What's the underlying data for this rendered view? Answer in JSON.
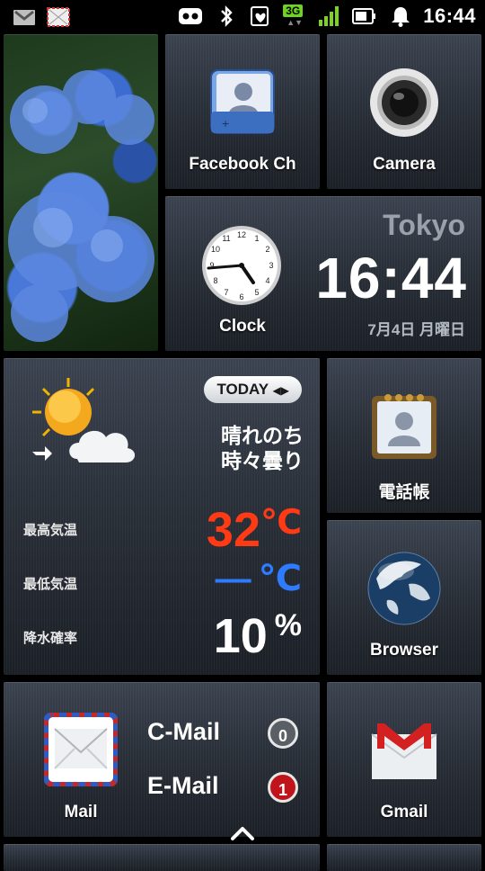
{
  "status_bar": {
    "left_icons": [
      "gmail-notification-icon",
      "mail-notification-icon"
    ],
    "right_icons": [
      "voicemail-icon",
      "bluetooth-icon",
      "heart-app-icon",
      "3g-icon",
      "signal-icon",
      "battery-icon",
      "alarm-bell-icon"
    ],
    "network": "3G",
    "time": "16:44"
  },
  "tiles": {
    "facebook": {
      "label": "Facebook Ch"
    },
    "camera": {
      "label": "Camera"
    },
    "clock": {
      "label": "Clock",
      "city": "Tokyo",
      "time": "16:44",
      "date": "7月4日 月曜日"
    },
    "weather": {
      "pill": "TODAY",
      "description_line1": "晴れのち",
      "description_line2": "時々曇り",
      "high_label": "最高気温",
      "high_value": "32",
      "high_unit": "℃",
      "low_label": "最低気温",
      "low_value": "—",
      "low_unit": "℃",
      "rain_label": "降水確率",
      "rain_value": "10",
      "rain_unit": "%"
    },
    "contacts": {
      "label": "電話帳"
    },
    "browser": {
      "label": "Browser"
    },
    "mail": {
      "label": "Mail",
      "cmail_label": "C-Mail",
      "cmail_count": "0",
      "email_label": "E-Mail",
      "email_count": "1"
    },
    "gmail": {
      "label": "Gmail"
    }
  },
  "colors": {
    "high_temp": "#ff3a14",
    "low_temp": "#2f7bff",
    "badge_unread": "#c0141a",
    "badge_zero": "#5a5f66"
  }
}
